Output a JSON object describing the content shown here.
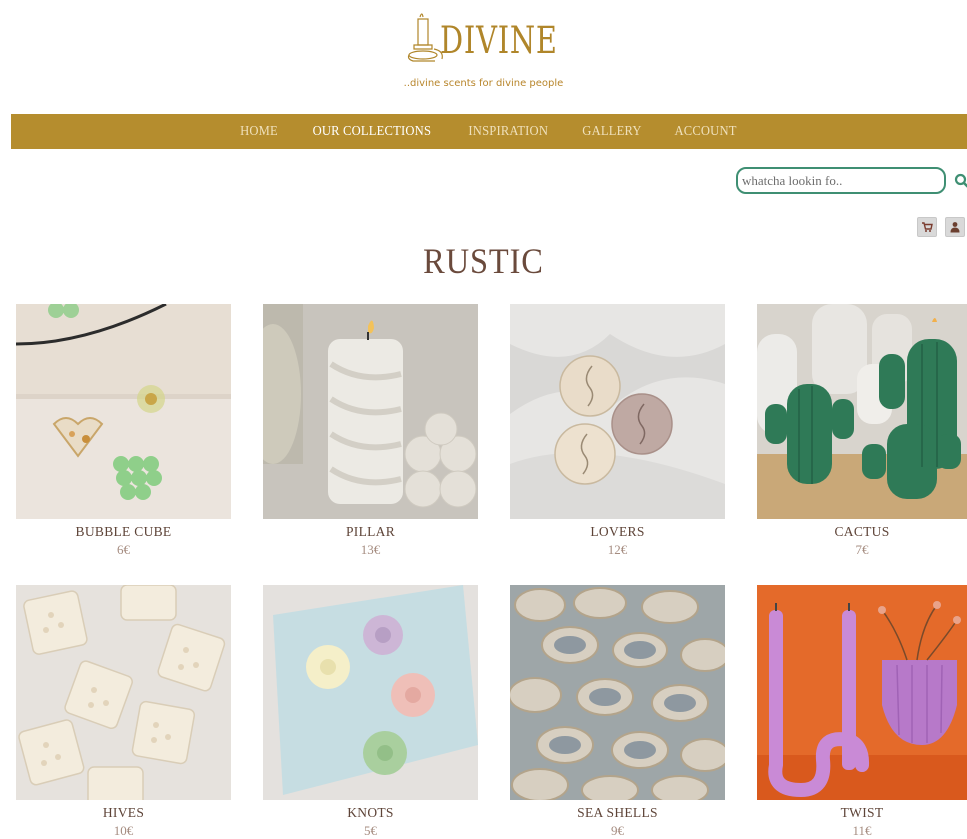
{
  "brand": {
    "name": "DIVINE",
    "tagline": "..divine scents for divine people"
  },
  "nav": {
    "items": [
      {
        "label": "HOME",
        "active": false
      },
      {
        "label": "OUR COLLECTIONS",
        "active": true
      },
      {
        "label": "INSPIRATION",
        "active": false
      },
      {
        "label": "GALLERY",
        "active": false
      },
      {
        "label": "ACCOUNT",
        "active": false
      }
    ]
  },
  "search": {
    "placeholder": "whatcha lookin fo..",
    "value": ""
  },
  "icons": {
    "search": "search-icon",
    "cart": "cart-icon",
    "user": "user-icon"
  },
  "colors": {
    "accent": "#b58d2e",
    "search_border": "#3f8f73",
    "title": "#6a4a3c"
  },
  "page": {
    "title": "RUSTIC"
  },
  "products": [
    {
      "name": "BUBBLE CUBE",
      "price": "6€"
    },
    {
      "name": "PILLAR",
      "price": "13€"
    },
    {
      "name": "LOVERS",
      "price": "12€"
    },
    {
      "name": "CACTUS",
      "price": "7€"
    },
    {
      "name": "HIVES",
      "price": "10€"
    },
    {
      "name": "KNOTS",
      "price": "5€"
    },
    {
      "name": "SEA SHELLS",
      "price": "9€"
    },
    {
      "name": "TWIST",
      "price": "11€"
    }
  ]
}
